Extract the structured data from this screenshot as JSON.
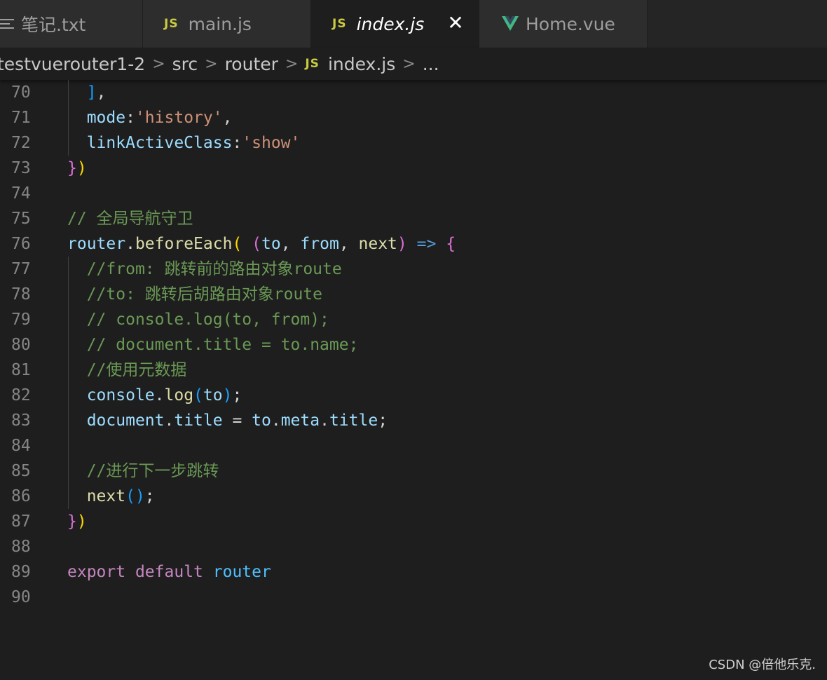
{
  "tabs": [
    {
      "label": "笔记.txt",
      "icon": "text-file-icon",
      "active": false
    },
    {
      "label": "main.js",
      "icon": "javascript-icon",
      "icon_text": "JS",
      "active": false
    },
    {
      "label": "index.js",
      "icon": "javascript-icon",
      "icon_text": "JS",
      "active": true,
      "close": "✕"
    },
    {
      "label": "Home.vue",
      "icon": "vue-icon",
      "active": false
    }
  ],
  "breadcrumb": {
    "items": [
      "testvuerouter1-2",
      "src",
      "router",
      "index.js",
      "..."
    ],
    "js_icon_text": "JS",
    "separator": ">"
  },
  "editor": {
    "lines": [
      {
        "n": "70",
        "tokens": [
          [
            "  ",
            "op"
          ],
          [
            "]",
            "c-br3"
          ],
          [
            ",",
            "op"
          ]
        ]
      },
      {
        "n": "71",
        "tokens": [
          [
            "  ",
            "op"
          ],
          [
            "mode",
            "var"
          ],
          [
            ":",
            "op"
          ],
          [
            "'history'",
            "str"
          ],
          [
            ",",
            "op"
          ]
        ]
      },
      {
        "n": "72",
        "tokens": [
          [
            "  ",
            "op"
          ],
          [
            "linkActiveClass",
            "var"
          ],
          [
            ":",
            "op"
          ],
          [
            "'show'",
            "str"
          ]
        ]
      },
      {
        "n": "73",
        "tokens": [
          [
            "}",
            "br2"
          ],
          [
            ")",
            "br1"
          ]
        ]
      },
      {
        "n": "74",
        "tokens": []
      },
      {
        "n": "75",
        "tokens": [
          [
            "// 全局导航守卫",
            "com"
          ]
        ]
      },
      {
        "n": "76",
        "tokens": [
          [
            "router",
            "var"
          ],
          [
            ".",
            "op"
          ],
          [
            "beforeEach",
            "fn"
          ],
          [
            "(",
            "br1"
          ],
          [
            " ",
            "op"
          ],
          [
            "(",
            "br2"
          ],
          [
            "to",
            "var"
          ],
          [
            ", ",
            "op"
          ],
          [
            "from",
            "var"
          ],
          [
            ", ",
            "op"
          ],
          [
            "next",
            "fn"
          ],
          [
            ")",
            "br2"
          ],
          [
            " ",
            "op"
          ],
          [
            "=>",
            "arrow"
          ],
          [
            " ",
            "op"
          ],
          [
            "{",
            "br2"
          ]
        ]
      },
      {
        "n": "77",
        "tokens": [
          [
            "  ",
            "op"
          ],
          [
            "//from: 跳转前的路由对象route",
            "com"
          ]
        ]
      },
      {
        "n": "78",
        "tokens": [
          [
            "  ",
            "op"
          ],
          [
            "//to: 跳转后胡路由对象route",
            "com"
          ]
        ]
      },
      {
        "n": "79",
        "tokens": [
          [
            "  ",
            "op"
          ],
          [
            "// console.log(to, from);",
            "com"
          ]
        ]
      },
      {
        "n": "80",
        "tokens": [
          [
            "  ",
            "op"
          ],
          [
            "// document.title = to.name;",
            "com"
          ]
        ]
      },
      {
        "n": "81",
        "tokens": [
          [
            "  ",
            "op"
          ],
          [
            "//使用元数据",
            "com"
          ]
        ]
      },
      {
        "n": "82",
        "tokens": [
          [
            "  ",
            "op"
          ],
          [
            "console",
            "var"
          ],
          [
            ".",
            "op"
          ],
          [
            "log",
            "fn"
          ],
          [
            "(",
            "br3"
          ],
          [
            "to",
            "var"
          ],
          [
            ")",
            "br3"
          ],
          [
            ";",
            "op"
          ]
        ]
      },
      {
        "n": "83",
        "tokens": [
          [
            "  ",
            "op"
          ],
          [
            "document",
            "var"
          ],
          [
            ".",
            "op"
          ],
          [
            "title",
            "var"
          ],
          [
            " = ",
            "op"
          ],
          [
            "to",
            "var"
          ],
          [
            ".",
            "op"
          ],
          [
            "meta",
            "var"
          ],
          [
            ".",
            "op"
          ],
          [
            "title",
            "var"
          ],
          [
            ";",
            "op"
          ]
        ]
      },
      {
        "n": "84",
        "tokens": []
      },
      {
        "n": "85",
        "tokens": [
          [
            "  ",
            "op"
          ],
          [
            "//进行下一步跳转",
            "com"
          ]
        ]
      },
      {
        "n": "86",
        "tokens": [
          [
            "  ",
            "op"
          ],
          [
            "next",
            "fn"
          ],
          [
            "()",
            "br3"
          ],
          [
            ";",
            "op"
          ]
        ]
      },
      {
        "n": "87",
        "tokens": [
          [
            "}",
            "br2"
          ],
          [
            ")",
            "br1"
          ]
        ]
      },
      {
        "n": "88",
        "tokens": []
      },
      {
        "n": "89",
        "tokens": [
          [
            "export",
            "kw"
          ],
          [
            " ",
            "op"
          ],
          [
            "default",
            "kw"
          ],
          [
            " ",
            "op"
          ],
          [
            "router",
            "blue"
          ]
        ]
      },
      {
        "n": "90",
        "tokens": []
      }
    ]
  },
  "watermark": "CSDN @倍他乐克.",
  "colors": {
    "background": "#1e1e1e",
    "tab_inactive": "#2d2d2d",
    "comment": "#6a9955",
    "variable": "#9cdcfe",
    "function": "#dcdcaa",
    "string": "#ce9178",
    "keyword": "#c586c0"
  }
}
